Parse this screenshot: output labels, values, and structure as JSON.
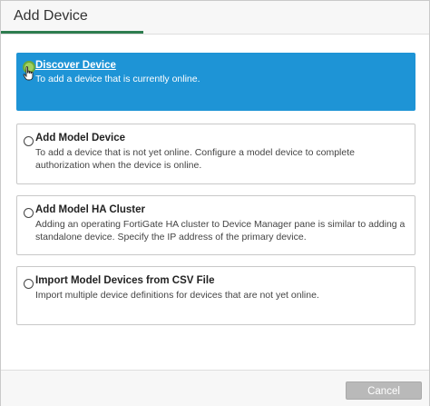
{
  "dialog": {
    "title": "Add Device",
    "accent_color": "#2e7d4f",
    "selected_color": "#1e94d6"
  },
  "options": [
    {
      "label": "Discover Device",
      "description": "To add a device that is currently online.",
      "selected": true
    },
    {
      "label": "Add Model Device",
      "description": "To add a device that is not yet online. Configure a model device to complete authorization when the device is online.",
      "selected": false
    },
    {
      "label": "Add Model HA Cluster",
      "description": "Adding an operating FortiGate HA cluster to Device Manager pane is similar to adding a standalone device. Specify the IP address of the primary device.",
      "selected": false
    },
    {
      "label": "Import Model Devices from CSV File",
      "description": "Import multiple device definitions for devices that are not yet online.",
      "selected": false
    }
  ],
  "footer": {
    "cancel_label": "Cancel"
  }
}
